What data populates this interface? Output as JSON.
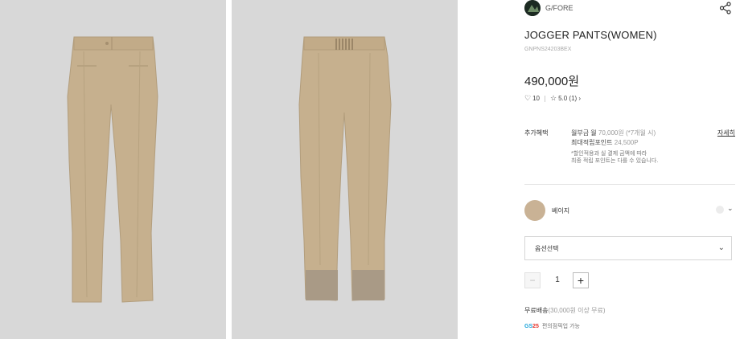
{
  "brand": {
    "name": "G/FORE",
    "logo_icon": "brand-logo-icon"
  },
  "product": {
    "title": "JOGGER PANTS(WOMEN)",
    "code": "GNPNS24203BEX",
    "price": "490,000원"
  },
  "meta": {
    "likes_icon": "heart-icon",
    "likes": "10",
    "rating_icon": "star-icon",
    "rating": "5.0 (1) ›"
  },
  "benefit": {
    "label": "추가혜택",
    "line1_main": "월부금 월 ",
    "line1_gray": "70,000원 (*7개월 시)",
    "line2_main": "최대적립포인트 ",
    "line2_gray": "24,500P",
    "note1": "*할인적용과 실 결제 금액에 따라",
    "note2": "최종 적립 포인트는 다를 수 있습니다.",
    "more": "자세히"
  },
  "color": {
    "name": "베이지",
    "swatch": "#c9b295"
  },
  "option": {
    "label": "옵션선택"
  },
  "quantity": {
    "minus": "−",
    "value": "1",
    "plus": "+"
  },
  "shipping": {
    "main": "무료배송",
    "gray": "(30,000원 이상 무료)"
  },
  "gs": {
    "logo_g": "GS",
    "logo_n": "25",
    "text": "편의점픽업 가능"
  },
  "colors": {
    "photo_bg": "#d8d8d8",
    "pants": "#c6b08e",
    "cuff": "#a99a86"
  }
}
